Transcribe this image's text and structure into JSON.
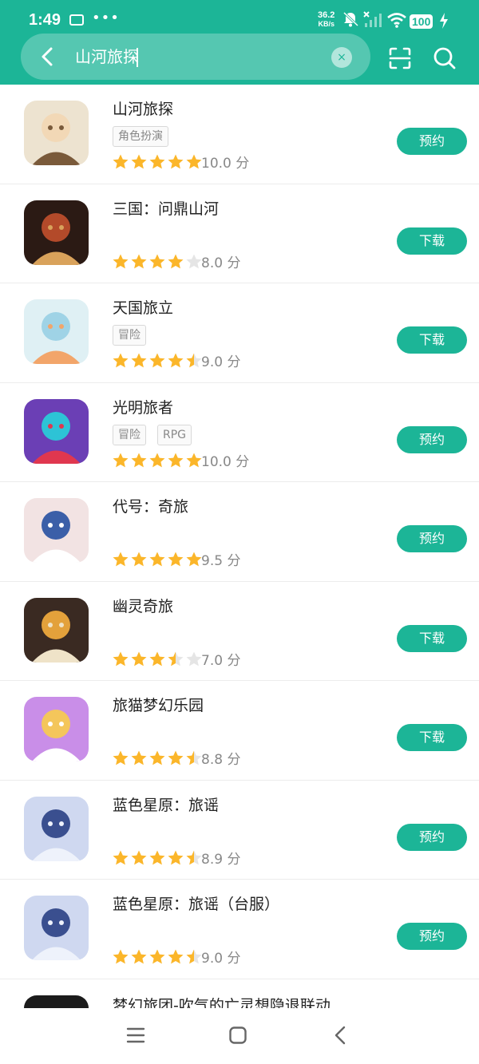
{
  "status_bar": {
    "time": "1:49",
    "net_speed": "36.2",
    "net_unit": "KB/s",
    "battery": "100"
  },
  "search": {
    "query": "山河旅探",
    "clear_icon": "×"
  },
  "colors": {
    "accent": "#1cb597",
    "star": "#fbb62a",
    "star_empty": "#e5e5e5"
  },
  "apps": [
    {
      "title": "山河旅探",
      "tags": [
        "角色扮演"
      ],
      "rating": 5,
      "score": "10.0 分",
      "action": "预约"
    },
    {
      "title": "三国：问鼎山河",
      "tags": [],
      "rating": 4,
      "score": "8.0 分",
      "action": "下载"
    },
    {
      "title": "天国旅立",
      "tags": [
        "冒险"
      ],
      "rating": 4.5,
      "score": "9.0 分",
      "action": "下载"
    },
    {
      "title": "光明旅者",
      "tags": [
        "冒险",
        "RPG"
      ],
      "rating": 5,
      "score": "10.0 分",
      "action": "预约"
    },
    {
      "title": "代号：奇旅",
      "tags": [],
      "rating": 5,
      "score": "9.5 分",
      "action": "预约"
    },
    {
      "title": "幽灵奇旅",
      "tags": [],
      "rating": 3.5,
      "score": "7.0 分",
      "action": "下载"
    },
    {
      "title": "旅猫梦幻乐园",
      "tags": [],
      "rating": 4.5,
      "score": "8.8 分",
      "action": "下载"
    },
    {
      "title": "蓝色星原：旅谣",
      "tags": [],
      "rating": 4.5,
      "score": "8.9 分",
      "action": "预约"
    },
    {
      "title": "蓝色星原：旅谣（台服）",
      "tags": [],
      "rating": 4.5,
      "score": "9.0 分",
      "action": "预约"
    }
  ],
  "partial_app": {
    "title": "梦幻旅团-吹气的亡灵想隐退联动"
  }
}
